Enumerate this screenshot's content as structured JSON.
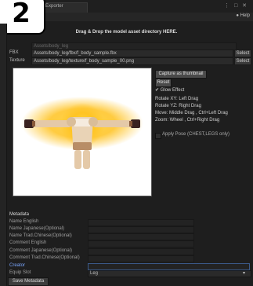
{
  "badge": {
    "number": "2"
  },
  "window": {
    "tab_title": "Exporter",
    "controls": "⋮ □ ✕",
    "help_label": "Help",
    "drop_hint": "Drag & Drop the model asset directory HERE."
  },
  "paths": {
    "folder_value": "Assets/body_leg",
    "fbx_label": "FBX",
    "fbx_value": "Assets/body_leg/fbx/f_body_sample.fbx",
    "texture_label": "Texture",
    "texture_value": "Assets/body_leg/texture/f_body_sample_00.png",
    "select_label": "Select"
  },
  "preview_controls": {
    "capture_label": "Capture as thumbnail",
    "reset_label": "Reset",
    "glow_label": "Glow Effect",
    "glow_checked": true,
    "help_lines": [
      "Rotate XY: Left Drag",
      "Rotate YZ: Right Drag",
      "Move: Middle Drag , Ctrl+Left Drag",
      "Zoom: Wheel , Ctrl+Right Drag"
    ],
    "apply_pose_label": "Apply Pose (CHEST,LEGS only)"
  },
  "metadata": {
    "heading": "Metadata",
    "fields": [
      {
        "label": "Name English",
        "value": ""
      },
      {
        "label": "Name Japanese(Optional)",
        "value": ""
      },
      {
        "label": "Name Trad.Chinese(Optional)",
        "value": ""
      },
      {
        "label": "Comment English",
        "value": ""
      },
      {
        "label": "Comment Japanese(Optional)",
        "value": ""
      },
      {
        "label": "Comment Trad.Chinese(Optional)",
        "value": ""
      },
      {
        "label": "Creator",
        "value": ""
      }
    ],
    "equip_slot_label": "Equip Slot",
    "equip_slot_value": "Leg",
    "save_label": "Save Metadata"
  },
  "colors": {
    "accent_label": "#7aa7ff",
    "glow": "#ffcc33"
  }
}
